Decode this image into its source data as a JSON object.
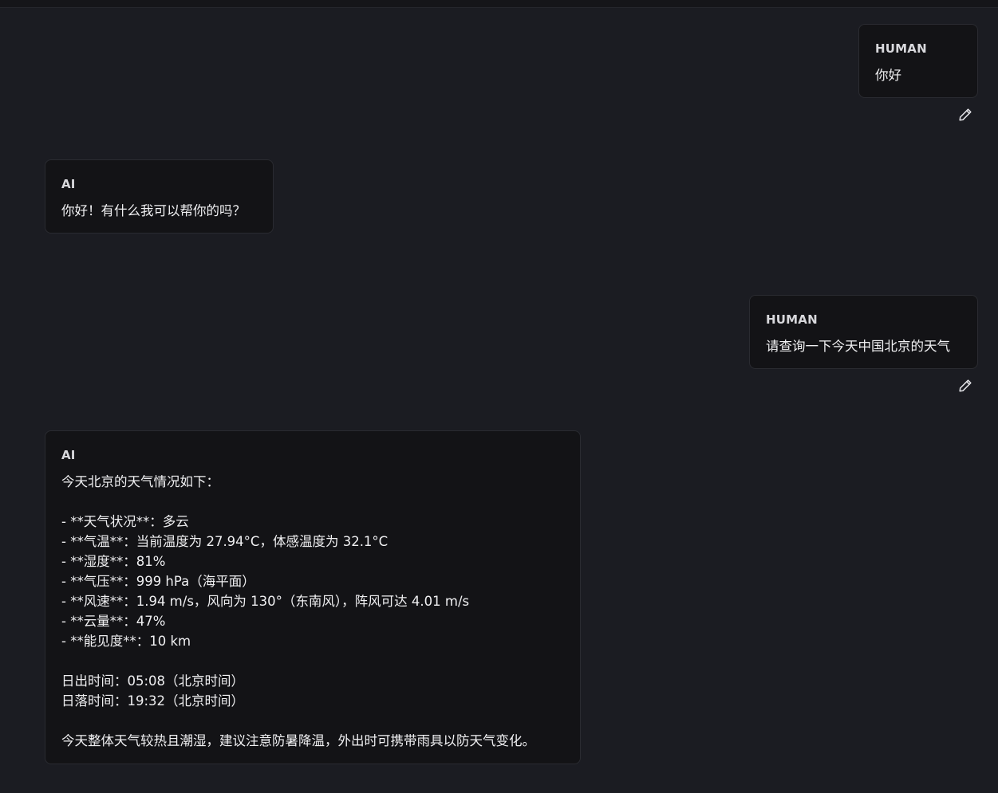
{
  "conversation": {
    "messages": [
      {
        "role": "HUMAN",
        "text": "你好"
      },
      {
        "role": "AI",
        "text": "你好！有什么我可以帮你的吗？"
      },
      {
        "role": "HUMAN",
        "text": "请查询一下今天中国北京的天气"
      },
      {
        "role": "AI",
        "text": "今天北京的天气情况如下：\n\n- **天气状况**：多云\n- **气温**：当前温度为 27.94°C，体感温度为 32.1°C\n- **湿度**：81%\n- **气压**：999 hPa（海平面）\n- **风速**：1.94 m/s，风向为 130°（东南风），阵风可达 4.01 m/s\n- **云量**：47%\n- **能见度**：10 km\n\n日出时间：05:08（北京时间）\n日落时间：19:32（北京时间）\n\n今天整体天气较热且潮湿，建议注意防暑降温，外出时可携带雨具以防天气变化。"
      }
    ],
    "edit_icon": "pencil-icon"
  },
  "colors": {
    "background": "#1b1c22",
    "bubble": "#131316",
    "border": "#2a2b31",
    "text": "#f0f0f2"
  }
}
